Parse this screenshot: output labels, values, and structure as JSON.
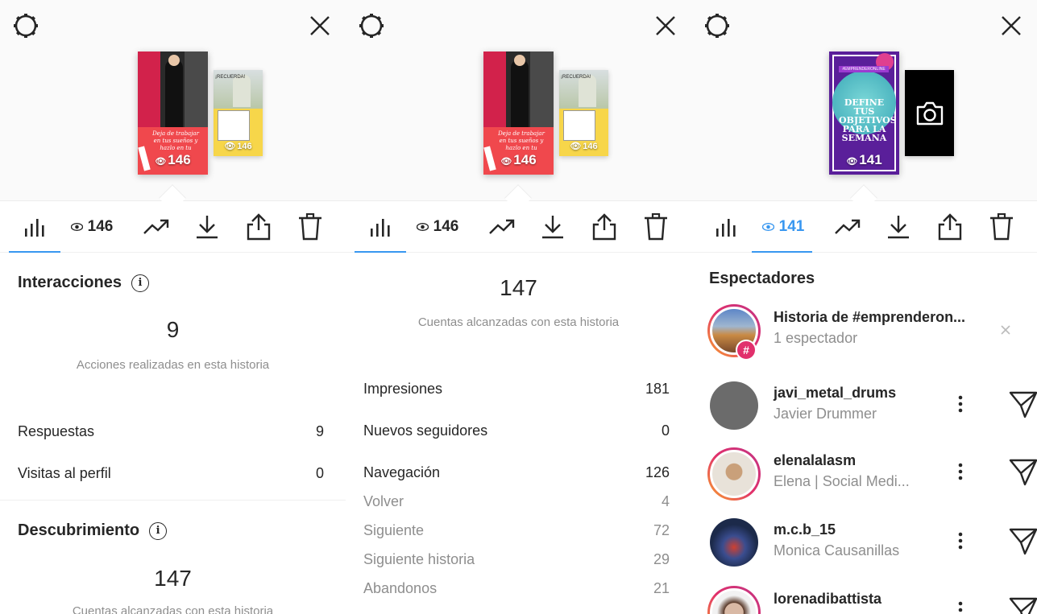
{
  "panel1": {
    "thumb_main_count": "146",
    "thumb_main_caption": "Deja de trabajar en tus sueños y hazlo en tu",
    "thumb_side_count": "146",
    "thumb_side_title": "¡RECUERDA!",
    "views": "146",
    "section1_title": "Interacciones",
    "interactions_value": "9",
    "interactions_label": "Acciones realizadas en esta historia",
    "rows": [
      {
        "label": "Respuestas",
        "value": "9"
      },
      {
        "label": "Visitas al perfil",
        "value": "0"
      }
    ],
    "section2_title": "Descubrimiento",
    "discovery_value": "147",
    "discovery_label": "Cuentas alcanzadas con esta historia"
  },
  "panel2": {
    "thumb_main_count": "146",
    "thumb_main_caption": "Deja de trabajar en tus sueños y hazlo en tu",
    "thumb_side_count": "146",
    "thumb_side_title": "¡RECUERDA!",
    "views": "146",
    "reach_value": "147",
    "reach_label": "Cuentas alcanzadas con esta historia",
    "rows": [
      {
        "label": "Impresiones",
        "value": "181"
      },
      {
        "label": "Nuevos seguidores",
        "value": "0"
      },
      {
        "label": "Navegación",
        "value": "126"
      }
    ],
    "nav_rows": [
      {
        "label": "Volver",
        "value": "4"
      },
      {
        "label": "Siguiente",
        "value": "72"
      },
      {
        "label": "Siguiente historia",
        "value": "29"
      },
      {
        "label": "Abandonos",
        "value": "21"
      }
    ]
  },
  "panel3": {
    "thumb_main_count": "141",
    "thumb_main_title": "DEFINE TUS OBJETIVOS PARA LA SEMANA",
    "thumb_main_tag": "#EMPRENDERONLINE",
    "views": "141",
    "section_title": "Espectadores",
    "hashtag_story": {
      "title": "Historia de #emprenderon...",
      "subtitle": "1 espectador"
    },
    "viewers": [
      {
        "username": "javi_metal_drums",
        "name": "Javier Drummer",
        "ring": false,
        "bg": "#6b6b6b"
      },
      {
        "username": "elenalalasm",
        "name": "Elena | Social Medi...",
        "ring": true,
        "bg": "#e8e2d9"
      },
      {
        "username": "m.c.b_15",
        "name": "Monica Causanillas",
        "ring": false,
        "bg": "#1c2a4a"
      },
      {
        "username": "lorenadibattista",
        "name": "",
        "ring": true,
        "bg": "#d9b9a5"
      }
    ]
  },
  "colors": {
    "accent": "#3897f0",
    "muted": "#8e8e8e",
    "text": "#262626"
  },
  "icons": [
    "settings-icon",
    "close-icon",
    "insights-icon",
    "eye-icon",
    "trending-icon",
    "download-icon",
    "share-icon",
    "trash-icon",
    "info-icon",
    "more-icon",
    "send-icon",
    "camera-icon",
    "hashtag-icon"
  ]
}
